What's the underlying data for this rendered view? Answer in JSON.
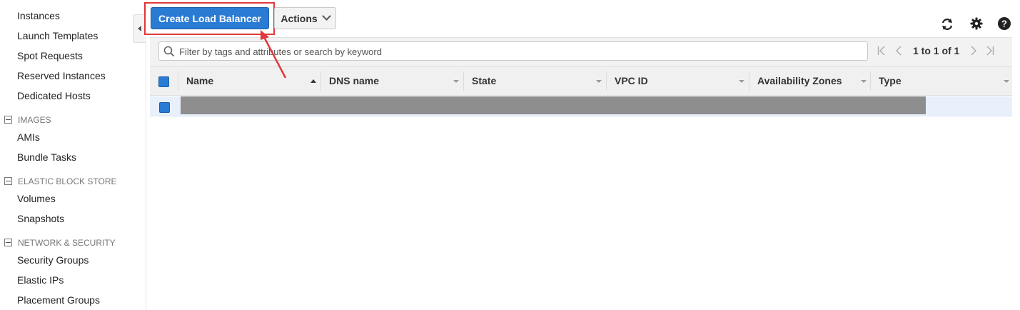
{
  "sidebar": {
    "items_top": [
      "Instances",
      "Launch Templates",
      "Spot Requests",
      "Reserved Instances",
      "Dedicated Hosts"
    ],
    "sections": [
      {
        "title": "IMAGES",
        "items": [
          "AMIs",
          "Bundle Tasks"
        ]
      },
      {
        "title": "ELASTIC BLOCK STORE",
        "items": [
          "Volumes",
          "Snapshots"
        ]
      },
      {
        "title": "NETWORK & SECURITY",
        "items": [
          "Security Groups",
          "Elastic IPs",
          "Placement Groups"
        ]
      }
    ]
  },
  "toolbar": {
    "create_label": "Create Load Balancer",
    "actions_label": "Actions"
  },
  "search": {
    "placeholder": "Filter by tags and attributes or search by keyword",
    "value": ""
  },
  "pager": {
    "text": "1 to 1 of 1"
  },
  "table": {
    "columns": [
      "Name",
      "DNS name",
      "State",
      "VPC ID",
      "Availability Zones",
      "Type"
    ],
    "sort_column": "Name",
    "rows": 1
  },
  "colors": {
    "primary": "#2a7bd4",
    "highlight": "#e0393b",
    "selected_row": "#e8f0fb"
  },
  "icons": [
    "sidebar-collapse-icon",
    "refresh-icon",
    "gear-icon",
    "help-icon",
    "search-icon",
    "first-page-icon",
    "prev-page-icon",
    "next-page-icon",
    "last-page-icon"
  ]
}
